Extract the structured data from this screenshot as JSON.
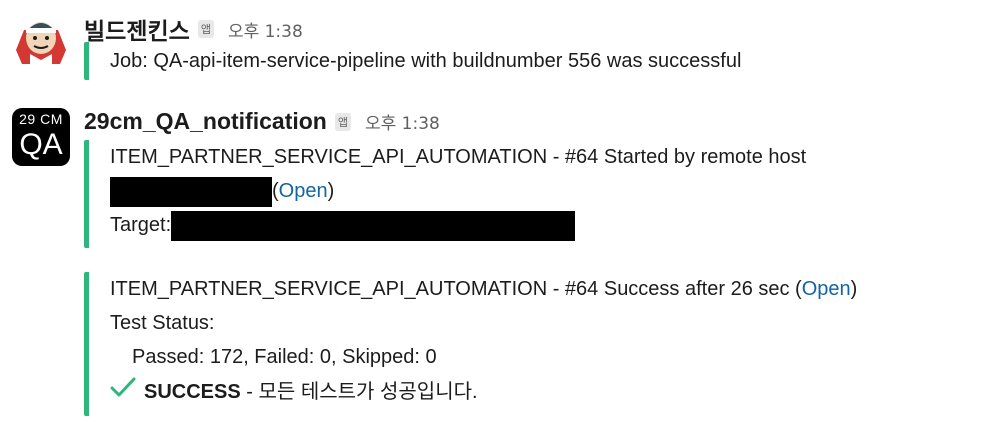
{
  "messages": [
    {
      "sender": "빌드젠킨스",
      "app_badge": "앱",
      "time": "오후 1:38",
      "attachment_lines": [
        "Job: QA-api-item-service-pipeline with buildnumber 556 was successful"
      ]
    },
    {
      "sender": "29cm_QA_notification",
      "app_badge": "앱",
      "time": "오후 1:38",
      "avatar_top": "29 CM",
      "avatar_main": "QA",
      "attachment1": {
        "line1": "ITEM_PARTNER_SERVICE_API_AUTOMATION - #64 Started by remote host",
        "open_paren_left": "(",
        "open_link": "Open",
        "open_paren_right": ")",
        "target_label": "Target:"
      },
      "attachment2": {
        "line1_prefix": "ITEM_PARTNER_SERVICE_API_AUTOMATION - #64 Success after 26 sec (",
        "open_link": "Open",
        "line1_suffix": ")",
        "test_status": "Test Status:",
        "results": "Passed: 172, Failed: 0, Skipped: 0",
        "success_word": "SUCCESS",
        "success_rest": " - 모든 테스트가 성공입니다."
      }
    }
  ],
  "colors": {
    "accent_green": "#2eb67d",
    "link_blue": "#1264a3",
    "redaction": "#000000"
  },
  "icons": {
    "jenkins_avatar": "jenkins-butler-icon",
    "check": "check-icon"
  }
}
